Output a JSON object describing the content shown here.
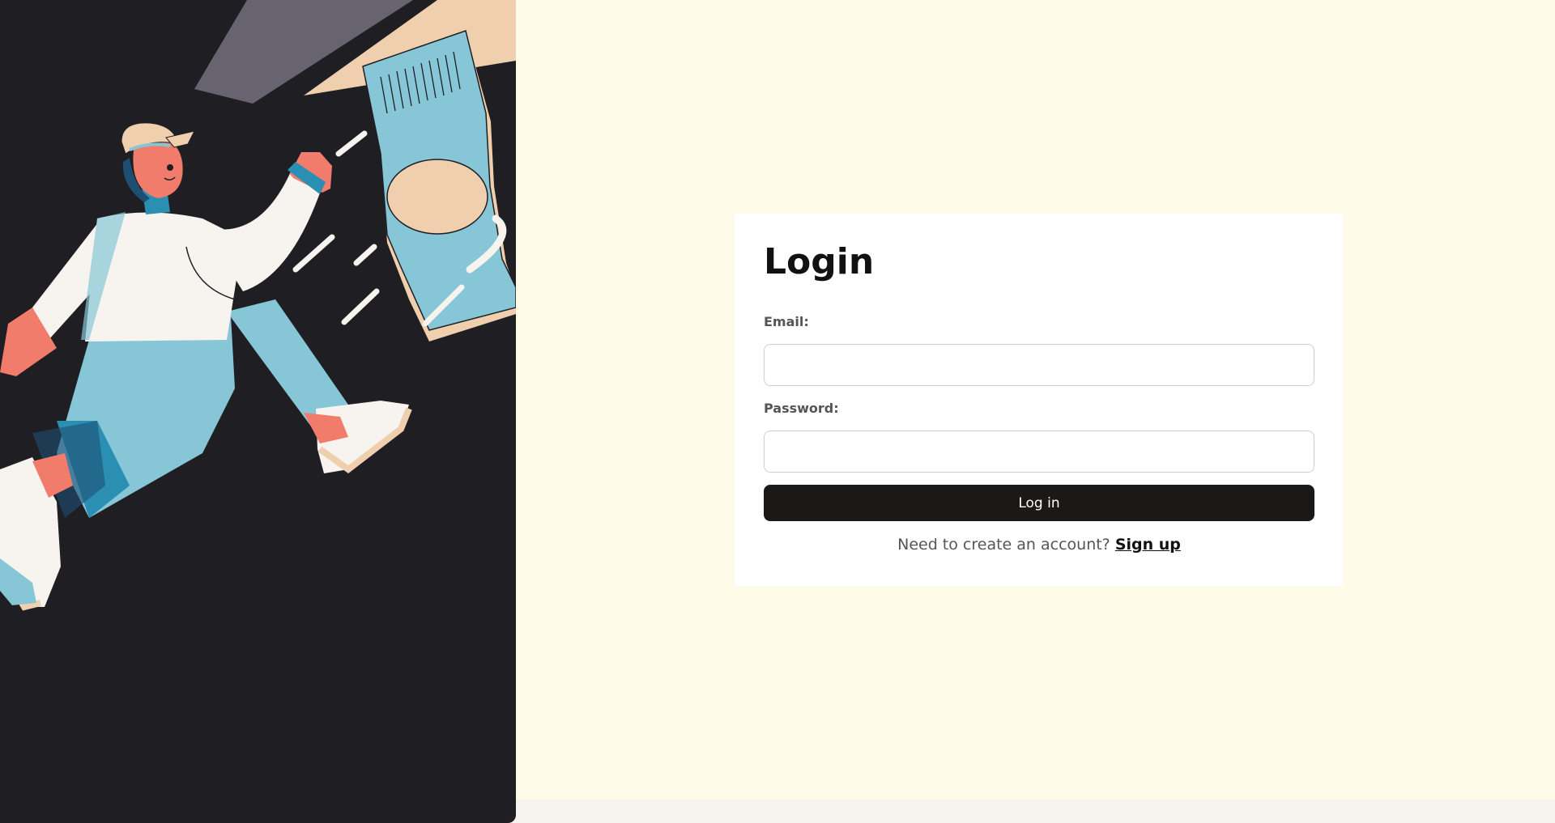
{
  "left_panel": {
    "illustration": "running-person-illustration",
    "background_color": "#1f1e23"
  },
  "login_card": {
    "title": "Login",
    "email_label": "Email:",
    "email_value": "",
    "email_placeholder": "",
    "password_label": "Password:",
    "password_value": "",
    "password_placeholder": "",
    "submit_label": "Log in",
    "signup_prompt": "Need to create an account?",
    "signup_link": "Sign up"
  },
  "colors": {
    "page_background": "#fffbe9",
    "card_background": "#ffffff",
    "button_background": "#1a1917",
    "illustration_blue": "#86c6d6",
    "illustration_skin": "#f27c6b",
    "illustration_beige": "#f0cfae"
  }
}
